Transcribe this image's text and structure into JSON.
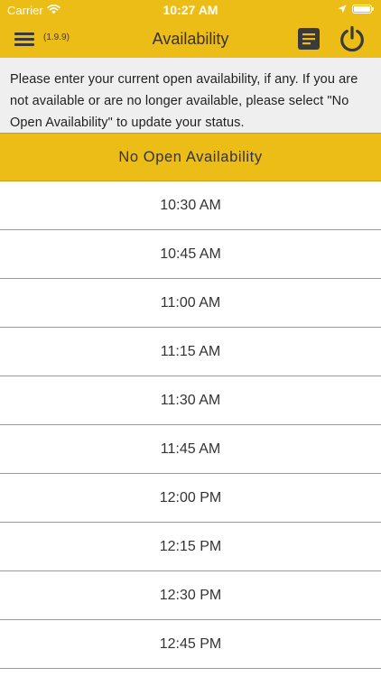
{
  "status_bar": {
    "carrier": "Carrier",
    "time": "10:27 AM"
  },
  "nav": {
    "version": "(1.9.9)",
    "title": "Availability",
    "menu_icon": "hamburger-menu-icon",
    "notes_icon": "notes-icon",
    "power_icon": "power-icon"
  },
  "instructions": "Please enter your current open availability, if any. If you are not available or are no longer available, please select \"No Open Availability\" to update your status.",
  "no_availability_label": "No Open Availability",
  "time_slots": [
    "10:30 AM",
    "10:45 AM",
    "11:00 AM",
    "11:15 AM",
    "11:30 AM",
    "11:45 AM",
    "12:00 PM",
    "12:15 PM",
    "12:30 PM",
    "12:45 PM"
  ],
  "colors": {
    "accent": "#EDBD17",
    "icon_dark": "#3a3a3a",
    "instructions_bg": "#efefef"
  }
}
